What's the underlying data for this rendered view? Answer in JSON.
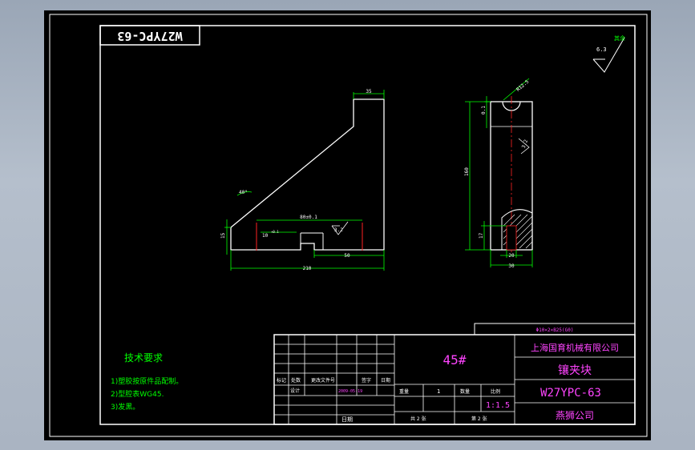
{
  "title_stamp": "W27YPC-63",
  "surface_finish": {
    "value": "6.3",
    "note": "其余"
  },
  "dimensions": {
    "top_width": "35",
    "angle": "40°",
    "left_height": "15",
    "slot_width": "80±0.1",
    "slot_tolerance": "10",
    "slot_tolerance_sup": "+0.1",
    "inner_finish": "3.2",
    "slot_depth": "50",
    "overall_length": "210",
    "radius_top": "R12.5",
    "top_offset": "0.1",
    "side_finish": "3.2",
    "overall_height": "160",
    "bottom_offset": "17",
    "hole_width": "20",
    "base_width": "30"
  },
  "bom_note": "Φ10×2×B25(G0)",
  "tech_requirements": {
    "heading": "技术要求",
    "items": [
      "1)塑胶按原件品配制。",
      "2)型腔表WG45.",
      "3)发黑。"
    ]
  },
  "title_block": {
    "material": "45#",
    "company": "上海国育机械有限公司",
    "part_name": "镶夹块",
    "drawing_no": "W27YPC-63",
    "dept": "燕狮公司",
    "scale_label": "比例",
    "scale_value": "1:1.5",
    "weight_label": "重量",
    "qty_label": "数量",
    "qty_value": "1",
    "sheet_total": "共 2 张",
    "sheet_no": "第 2 张",
    "rev_headers": [
      "标记",
      "处数",
      "更改文件号",
      "签字",
      "日期"
    ],
    "design_label": "设计",
    "design_date": "2009-05-19",
    "date_label": "日期"
  }
}
